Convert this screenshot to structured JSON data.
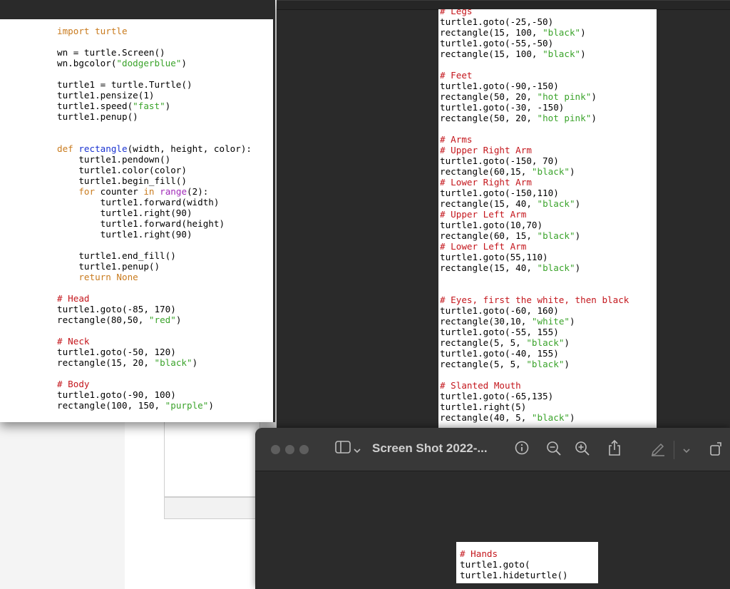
{
  "preview_window": {
    "title": "Screen Shot 2022-...",
    "toolbar_icons": [
      "sidebar-icon",
      "chevron-down-icon",
      "info-icon",
      "zoom-out-icon",
      "zoom-in-icon",
      "share-icon",
      "markup-pen-icon",
      "chevron-down-icon",
      "rotate-icon"
    ]
  },
  "left_code": [
    [
      [
        "import turtle",
        "kw"
      ]
    ],
    [],
    [
      [
        "wn = turtle.Screen()",
        ""
      ]
    ],
    [
      [
        "wn.bgcolor(",
        ""
      ],
      [
        "\"dodgerblue\"",
        "st"
      ],
      [
        ")",
        ""
      ]
    ],
    [],
    [
      [
        "turtle1 = turtle.Turtle()",
        ""
      ]
    ],
    [
      [
        "turtle1.pensize(1)",
        ""
      ]
    ],
    [
      [
        "turtle1.speed(",
        ""
      ],
      [
        "\"fast\"",
        "st"
      ],
      [
        ")",
        ""
      ]
    ],
    [
      [
        "turtle1.penup()",
        ""
      ]
    ],
    [],
    [],
    [
      [
        "def ",
        "kw"
      ],
      [
        "rectangle",
        "fn"
      ],
      [
        "(width, height, color):",
        ""
      ]
    ],
    [
      [
        "    turtle1.pendown()",
        ""
      ]
    ],
    [
      [
        "    turtle1.color(color)",
        ""
      ]
    ],
    [
      [
        "    turtle1.begin_fill()",
        ""
      ]
    ],
    [
      [
        "    ",
        ""
      ],
      [
        "for",
        "kw"
      ],
      [
        " counter ",
        ""
      ],
      [
        "in",
        "kw"
      ],
      [
        " ",
        ""
      ],
      [
        "range",
        "bi"
      ],
      [
        "(2):",
        ""
      ]
    ],
    [
      [
        "        turtle1.forward(width)",
        ""
      ]
    ],
    [
      [
        "        turtle1.right(90)",
        ""
      ]
    ],
    [
      [
        "        turtle1.forward(height)",
        ""
      ]
    ],
    [
      [
        "        turtle1.right(90)",
        ""
      ]
    ],
    [],
    [
      [
        "    turtle1.end_fill()",
        ""
      ]
    ],
    [
      [
        "    turtle1.penup()",
        ""
      ]
    ],
    [
      [
        "    ",
        ""
      ],
      [
        "return None",
        "kw"
      ]
    ],
    [],
    [
      [
        "# Head",
        "cm"
      ]
    ],
    [
      [
        "turtle1.goto(-85, 170)",
        ""
      ]
    ],
    [
      [
        "rectangle(80,50, ",
        ""
      ],
      [
        "\"red\"",
        "st"
      ],
      [
        ")",
        ""
      ]
    ],
    [],
    [
      [
        "# Neck",
        "cm"
      ]
    ],
    [
      [
        "turtle1.goto(-50, 120)",
        ""
      ]
    ],
    [
      [
        "rectangle(15, 20, ",
        ""
      ],
      [
        "\"black\"",
        "st"
      ],
      [
        ")",
        ""
      ]
    ],
    [],
    [
      [
        "# Body",
        "cm"
      ]
    ],
    [
      [
        "turtle1.goto(-90, 100)",
        ""
      ]
    ],
    [
      [
        "rectangle(100, 150, ",
        ""
      ],
      [
        "\"purple\"",
        "st"
      ],
      [
        ")",
        ""
      ]
    ]
  ],
  "right_code": [
    [
      [
        "# Legs",
        "cm"
      ]
    ],
    [
      [
        "turtle1.goto(-25,-50)",
        ""
      ]
    ],
    [
      [
        "rectangle(15, 100, ",
        ""
      ],
      [
        "\"black\"",
        "st"
      ],
      [
        ")",
        ""
      ]
    ],
    [
      [
        "turtle1.goto(-55,-50)",
        ""
      ]
    ],
    [
      [
        "rectangle(15, 100, ",
        ""
      ],
      [
        "\"black\"",
        "st"
      ],
      [
        ")",
        ""
      ]
    ],
    [],
    [
      [
        "# Feet",
        "cm"
      ]
    ],
    [
      [
        "turtle1.goto(-90,-150)",
        ""
      ]
    ],
    [
      [
        "rectangle(50, 20, ",
        ""
      ],
      [
        "\"hot pink\"",
        "st"
      ],
      [
        ")",
        ""
      ]
    ],
    [
      [
        "turtle1.goto(-30, -150)",
        ""
      ]
    ],
    [
      [
        "rectangle(50, 20, ",
        ""
      ],
      [
        "\"hot pink\"",
        "st"
      ],
      [
        ")",
        ""
      ]
    ],
    [],
    [
      [
        "# Arms",
        "cm"
      ]
    ],
    [
      [
        "# Upper Right Arm",
        "cm"
      ]
    ],
    [
      [
        "turtle1.goto(-150, 70)",
        ""
      ]
    ],
    [
      [
        "rectangle(60,15, ",
        ""
      ],
      [
        "\"black\"",
        "st"
      ],
      [
        ")",
        ""
      ]
    ],
    [
      [
        "# Lower Right Arm",
        "cm"
      ]
    ],
    [
      [
        "turtle1.goto(-150,110)",
        ""
      ]
    ],
    [
      [
        "rectangle(15, 40, ",
        ""
      ],
      [
        "\"black\"",
        "st"
      ],
      [
        ")",
        ""
      ]
    ],
    [
      [
        "# Upper Left Arm",
        "cm"
      ]
    ],
    [
      [
        "turtle1.goto(10,70)",
        ""
      ]
    ],
    [
      [
        "rectangle(60, 15, ",
        ""
      ],
      [
        "\"black\"",
        "st"
      ],
      [
        ")",
        ""
      ]
    ],
    [
      [
        "# Lower Left Arm",
        "cm"
      ]
    ],
    [
      [
        "turtle1.goto(55,110)",
        ""
      ]
    ],
    [
      [
        "rectangle(15, 40, ",
        ""
      ],
      [
        "\"black\"",
        "st"
      ],
      [
        ")",
        ""
      ]
    ],
    [],
    [],
    [
      [
        "# Eyes, first the white, then black",
        "cm"
      ]
    ],
    [
      [
        "turtle1.goto(-60, 160)",
        ""
      ]
    ],
    [
      [
        "rectangle(30,10, ",
        ""
      ],
      [
        "\"white\"",
        "st"
      ],
      [
        ")",
        ""
      ]
    ],
    [
      [
        "turtle1.goto(-55, 155)",
        ""
      ]
    ],
    [
      [
        "rectangle(5, 5, ",
        ""
      ],
      [
        "\"black\"",
        "st"
      ],
      [
        ")",
        ""
      ]
    ],
    [
      [
        "turtle1.goto(-40, 155)",
        ""
      ]
    ],
    [
      [
        "rectangle(5, 5, ",
        ""
      ],
      [
        "\"black\"",
        "st"
      ],
      [
        ")",
        ""
      ]
    ],
    [],
    [
      [
        "# Slanted Mouth",
        "cm"
      ]
    ],
    [
      [
        "turtle1.goto(-65,135)",
        ""
      ]
    ],
    [
      [
        "turtle1.right(5)",
        ""
      ]
    ],
    [
      [
        "rectangle(40, 5, ",
        ""
      ],
      [
        "\"black\"",
        "st"
      ],
      [
        ")",
        ""
      ]
    ]
  ],
  "bottom_code": [
    [
      [
        "# Hands",
        "cm"
      ]
    ],
    [
      [
        "turtle1.goto(",
        ""
      ]
    ],
    [
      [
        "turtle1.hideturtle()",
        ""
      ]
    ]
  ]
}
